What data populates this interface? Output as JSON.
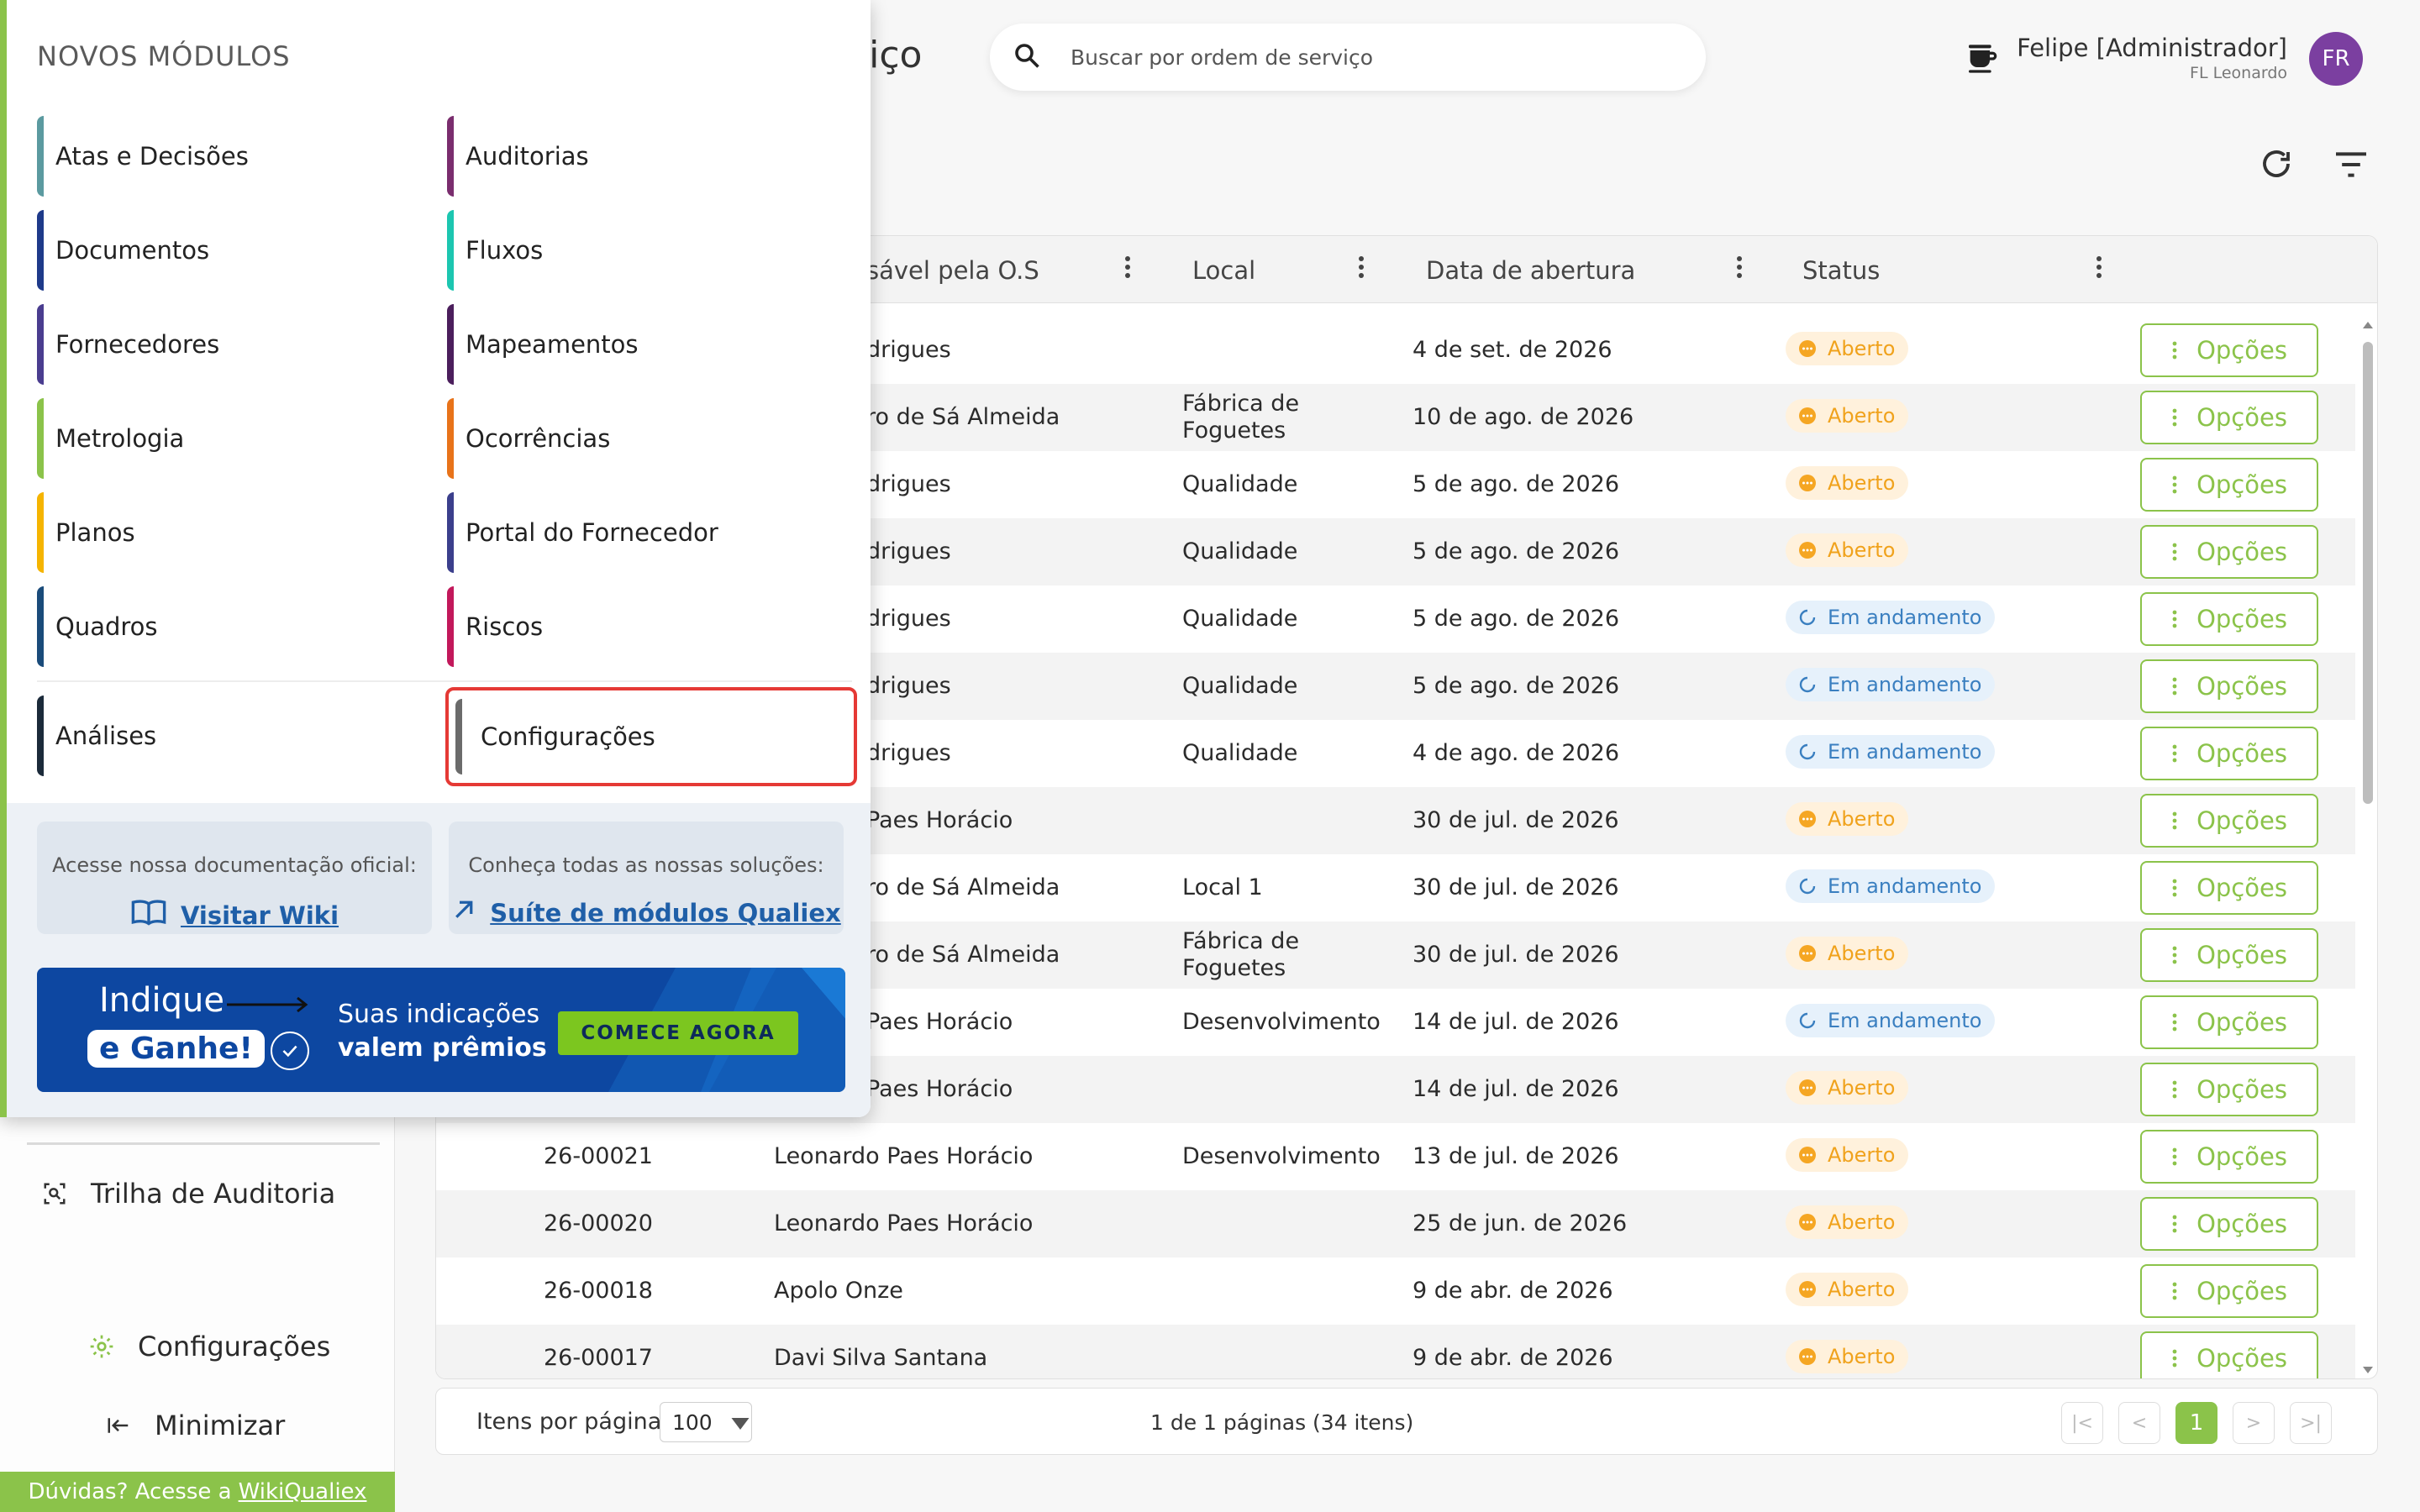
{
  "header": {
    "title_partial": "rviço",
    "search_placeholder": "Buscar por ordem de serviço",
    "user_name": "Felipe [Administrador]",
    "user_sub": "FL Leonardo",
    "avatar_initials": "FR"
  },
  "sidebar": {
    "audit_label": "Trilha de Auditoria",
    "config_label": "Configurações",
    "minimize_label": "Minimizar",
    "footer_text": "Dúvidas? Acesse a",
    "footer_link": "WikiQualiex"
  },
  "table": {
    "columns": [
      "sável pela O.S",
      "Local",
      "Data de abertura",
      "Status"
    ],
    "options_label": "Opções",
    "rows": [
      {
        "code": "",
        "resp": "drigues",
        "local": "",
        "local2": "",
        "date": "4 de set. de 2026",
        "status": "Aberto",
        "kind": "aberto"
      },
      {
        "code": "",
        "resp": "ro de Sá Almeida",
        "local": "Fábrica de",
        "local2": "Foguetes",
        "date": "10 de ago. de 2026",
        "status": "Aberto",
        "kind": "aberto"
      },
      {
        "code": "",
        "resp": "drigues",
        "local": "Qualidade",
        "local2": "",
        "date": "5 de ago. de 2026",
        "status": "Aberto",
        "kind": "aberto"
      },
      {
        "code": "",
        "resp": "drigues",
        "local": "Qualidade",
        "local2": "",
        "date": "5 de ago. de 2026",
        "status": "Aberto",
        "kind": "aberto"
      },
      {
        "code": "",
        "resp": "drigues",
        "local": "Qualidade",
        "local2": "",
        "date": "5 de ago. de 2026",
        "status": "Em andamento",
        "kind": "andamento"
      },
      {
        "code": "",
        "resp": "drigues",
        "local": "Qualidade",
        "local2": "",
        "date": "5 de ago. de 2026",
        "status": "Em andamento",
        "kind": "andamento"
      },
      {
        "code": "",
        "resp": "drigues",
        "local": "Qualidade",
        "local2": "",
        "date": "4 de ago. de 2026",
        "status": "Em andamento",
        "kind": "andamento"
      },
      {
        "code": "",
        "resp": "Paes Horácio",
        "local": "",
        "local2": "",
        "date": "30 de jul. de 2026",
        "status": "Aberto",
        "kind": "aberto"
      },
      {
        "code": "",
        "resp": "ro de Sá Almeida",
        "local": "Local 1",
        "local2": "",
        "date": "30 de jul. de 2026",
        "status": "Em andamento",
        "kind": "andamento"
      },
      {
        "code": "",
        "resp": "ro de Sá Almeida",
        "local": "Fábrica de",
        "local2": "Foguetes",
        "date": "30 de jul. de 2026",
        "status": "Aberto",
        "kind": "aberto"
      },
      {
        "code": "",
        "resp": "Paes Horácio",
        "local": "Desenvolvimento",
        "local2": "",
        "date": "14 de jul. de 2026",
        "status": "Em andamento",
        "kind": "andamento"
      },
      {
        "code": "",
        "resp": "Paes Horácio",
        "local": "",
        "local2": "",
        "date": "14 de jul. de 2026",
        "status": "Aberto",
        "kind": "aberto"
      },
      {
        "code": "26-00021",
        "resp": "Leonardo Paes Horácio",
        "local": "Desenvolvimento",
        "local2": "",
        "date": "13 de jul. de 2026",
        "status": "Aberto",
        "kind": "aberto"
      },
      {
        "code": "26-00020",
        "resp": "Leonardo Paes Horácio",
        "local": "",
        "local2": "",
        "date": "25 de jun. de 2026",
        "status": "Aberto",
        "kind": "aberto"
      },
      {
        "code": "26-00018",
        "resp": "Apolo Onze",
        "local": "",
        "local2": "",
        "date": "9 de abr. de 2026",
        "status": "Aberto",
        "kind": "aberto"
      },
      {
        "code": "26-00017",
        "resp": "Davi Silva Santana",
        "local": "",
        "local2": "",
        "date": "9 de abr. de 2026",
        "status": "Aberto",
        "kind": "aberto"
      }
    ]
  },
  "pagination": {
    "items_label": "Itens por página",
    "page_size": "100",
    "info": "1 de 1 páginas (34 itens)",
    "current_page": "1"
  },
  "popup": {
    "title": "NOVOS MÓDULOS",
    "modules_left": [
      {
        "label": "Atas e Decisões",
        "color": "#5b9aa0"
      },
      {
        "label": "Documentos",
        "color": "#1e3a8a"
      },
      {
        "label": "Fornecedores",
        "color": "#4a3d8f"
      },
      {
        "label": "Metrologia",
        "color": "#8bc34a"
      },
      {
        "label": "Planos",
        "color": "#f5b400"
      },
      {
        "label": "Quadros",
        "color": "#1a4b7a"
      }
    ],
    "modules_right": [
      {
        "label": "Auditorias",
        "color": "#7a2d6e"
      },
      {
        "label": "Fluxos",
        "color": "#1cc6b0"
      },
      {
        "label": "Mapeamentos",
        "color": "#4b1e5c"
      },
      {
        "label": "Ocorrências",
        "color": "#e8731a"
      },
      {
        "label": "Portal do Fornecedor",
        "color": "#3b3f8c"
      },
      {
        "label": "Riscos",
        "color": "#c2185b"
      }
    ],
    "analises": {
      "label": "Análises",
      "color": "#1b2a3a"
    },
    "configuracoes": {
      "label": "Configurações",
      "color": "#6b6b6b"
    },
    "doc_label": "Acesse nossa documentação oficial:",
    "doc_link": "Visitar Wiki",
    "suite_label": "Conheça todas as nossas soluções:",
    "suite_link": "Suíte de módulos Qualiex",
    "banner": {
      "indique": "Indique",
      "ganhe": "e Ganhe!",
      "line1": "Suas indicações",
      "line2": "valem prêmios",
      "cta": "COMECE AGORA"
    }
  },
  "colors": {
    "accent": "#8bc34a",
    "highlight": "#e53935",
    "aberto": "#f0a21c",
    "andamento": "#3a7fc0",
    "banner": "#0d47a1"
  }
}
